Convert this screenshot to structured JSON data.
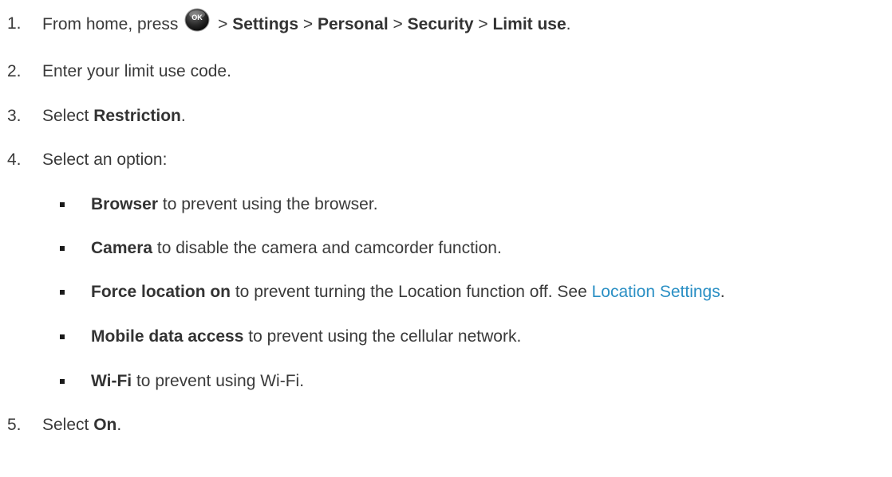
{
  "steps": [
    {
      "number": "1.",
      "prefix": "From home, press",
      "button_label": "OK",
      "sep1": ">",
      "path1": "Settings",
      "sep2": ">",
      "path2": "Personal",
      "sep3": ">",
      "path3": "Security",
      "sep4": ">",
      "path4": "Limit use",
      "suffix": "."
    },
    {
      "number": "2.",
      "text": "Enter your limit use code."
    },
    {
      "number": "3.",
      "prefix": "Select ",
      "bold": "Restriction",
      "suffix": "."
    },
    {
      "number": "4.",
      "text": "Select an option:"
    },
    {
      "number": "5.",
      "prefix": "Select ",
      "bold": "On",
      "suffix": "."
    }
  ],
  "options": [
    {
      "bold": "Browser",
      "text": " to prevent using the browser."
    },
    {
      "bold": "Camera",
      "text": " to disable the camera and camcorder function."
    },
    {
      "bold": "Force location on",
      "text": " to prevent turning the Location function off. See ",
      "link": "Location Settings",
      "suffix": "."
    },
    {
      "bold": "Mobile data access",
      "text": " to prevent using the cellular network."
    },
    {
      "bold": "Wi-Fi",
      "text": " to prevent using Wi-Fi."
    }
  ]
}
